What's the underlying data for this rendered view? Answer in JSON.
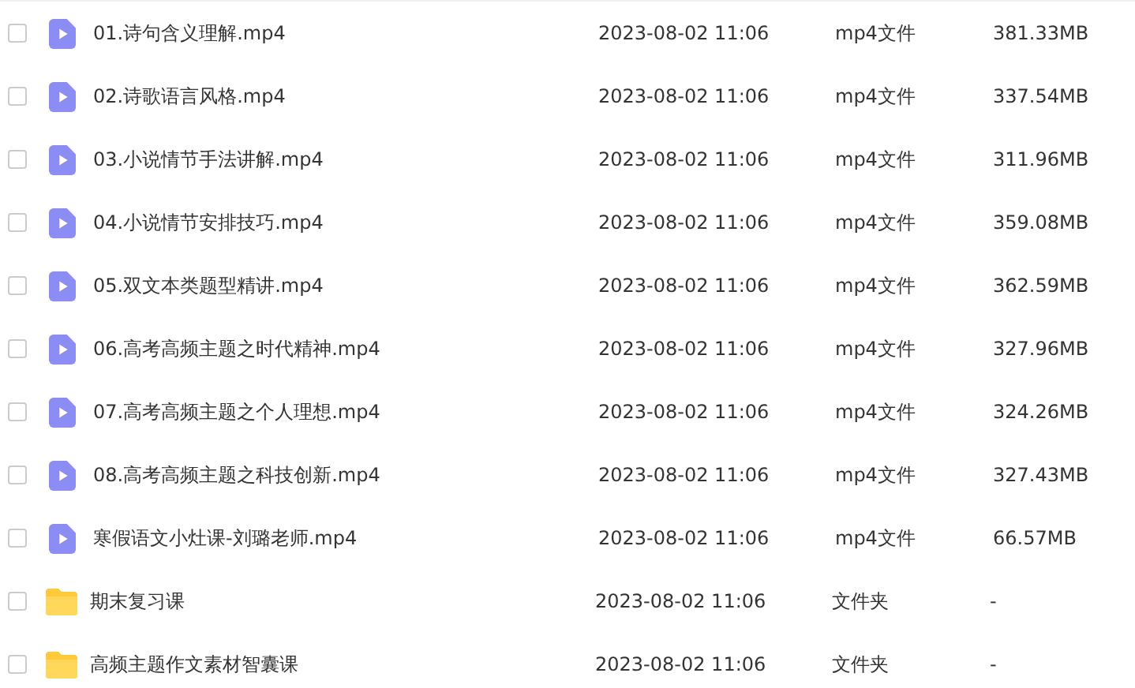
{
  "files": [
    {
      "kind": "video",
      "selected": false,
      "name": "01.诗句含义理解.mp4",
      "modified": "2023-08-02 11:06",
      "type": "mp4文件",
      "size": "381.33MB"
    },
    {
      "kind": "video",
      "selected": false,
      "name": "02.诗歌语言风格.mp4",
      "modified": "2023-08-02 11:06",
      "type": "mp4文件",
      "size": "337.54MB"
    },
    {
      "kind": "video",
      "selected": false,
      "name": "03.小说情节手法讲解.mp4",
      "modified": "2023-08-02 11:06",
      "type": "mp4文件",
      "size": "311.96MB"
    },
    {
      "kind": "video",
      "selected": false,
      "name": "04.小说情节安排技巧.mp4",
      "modified": "2023-08-02 11:06",
      "type": "mp4文件",
      "size": "359.08MB"
    },
    {
      "kind": "video",
      "selected": false,
      "name": "05.双文本类题型精讲.mp4",
      "modified": "2023-08-02 11:06",
      "type": "mp4文件",
      "size": "362.59MB"
    },
    {
      "kind": "video",
      "selected": false,
      "name": "06.高考高频主题之时代精神.mp4",
      "modified": "2023-08-02 11:06",
      "type": "mp4文件",
      "size": "327.96MB"
    },
    {
      "kind": "video",
      "selected": false,
      "name": "07.高考高频主题之个人理想.mp4",
      "modified": "2023-08-02 11:06",
      "type": "mp4文件",
      "size": "324.26MB"
    },
    {
      "kind": "video",
      "selected": false,
      "name": "08.高考高频主题之科技创新.mp4",
      "modified": "2023-08-02 11:06",
      "type": "mp4文件",
      "size": "327.43MB"
    },
    {
      "kind": "video",
      "selected": false,
      "name": "寒假语文小灶课-刘璐老师.mp4",
      "modified": "2023-08-02 11:06",
      "type": "mp4文件",
      "size": "66.57MB"
    },
    {
      "kind": "folder",
      "selected": false,
      "name": "期末复习课",
      "modified": "2023-08-02 11:06",
      "type": "文件夹",
      "size": "-"
    },
    {
      "kind": "folder",
      "selected": false,
      "name": "高频主题作文素材智囊课",
      "modified": "2023-08-02 11:06",
      "type": "文件夹",
      "size": "-"
    }
  ]
}
